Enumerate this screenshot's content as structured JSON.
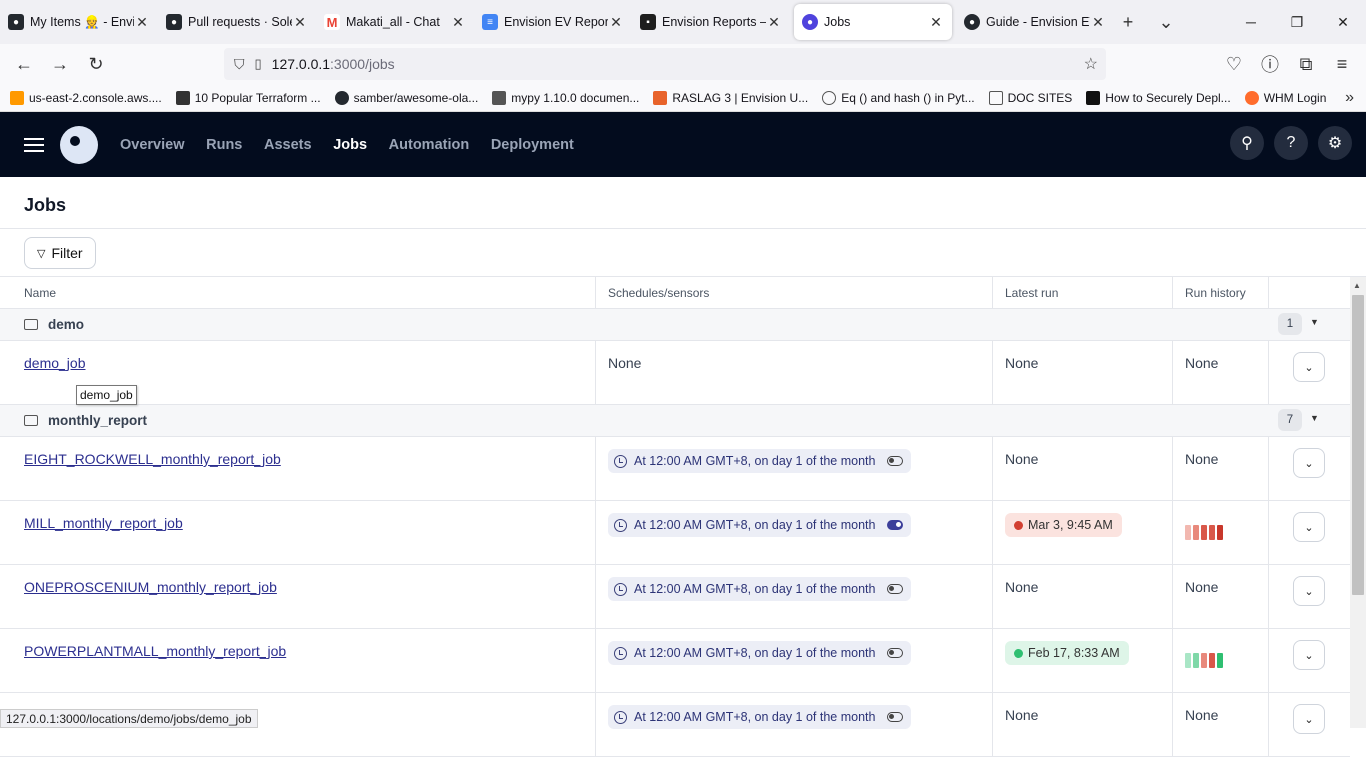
{
  "browser": {
    "tabs": [
      {
        "label": "My Items 👷 - Envis",
        "icon": "github-icon",
        "color": "#24292f"
      },
      {
        "label": "Pull requests · Soler",
        "icon": "github-icon",
        "color": "#24292f"
      },
      {
        "label": "Makati_all - Chat",
        "icon": "gmail-icon",
        "color": "#ea4335"
      },
      {
        "label": "Envision EV Report",
        "icon": "docs-icon",
        "color": "#4285f4"
      },
      {
        "label": "Envision Reports –",
        "icon": "figma-icon",
        "color": "#1e1e1e"
      },
      {
        "label": "Jobs",
        "icon": "dagster-icon",
        "color": "#4f43dd",
        "active": true
      },
      {
        "label": "Guide - Envision EV",
        "icon": "github-icon",
        "color": "#24292f"
      }
    ],
    "new_tab": "+",
    "tab_list": "⌄",
    "url_host": "127.0.0.1",
    "url_path": ":3000/jobs",
    "bookmarks": [
      {
        "label": "us-east-2.console.aws....",
        "color": "#ff9900"
      },
      {
        "label": "10 Popular Terraform ...",
        "color": "#333333"
      },
      {
        "label": "samber/awesome-ola...",
        "color": "#24292f"
      },
      {
        "label": "mypy 1.10.0 documen...",
        "color": "#555555"
      },
      {
        "label": "RASLAG 3 | Envision U...",
        "color": "#e8632b"
      },
      {
        "label": "Eq () and hash () in Pyt...",
        "color": "#666666"
      },
      {
        "label": "DOC SITES",
        "color": "#777777"
      },
      {
        "label": "How to Securely Depl...",
        "color": "#111111"
      },
      {
        "label": "WHM Login",
        "color": "#ff6c2c"
      }
    ],
    "status_url": "127.0.0.1:3000/locations/demo/jobs/demo_job"
  },
  "app": {
    "nav": [
      "Overview",
      "Runs",
      "Assets",
      "Jobs",
      "Automation",
      "Deployment"
    ],
    "active_nav": "Jobs",
    "page_title": "Jobs",
    "filter_label": "Filter"
  },
  "table": {
    "headers": [
      "Name",
      "Schedules/sensors",
      "Latest run",
      "Run history"
    ],
    "groups": [
      {
        "name": "demo",
        "count": "1"
      },
      {
        "name": "monthly_report",
        "count": "7"
      }
    ],
    "rows": [
      {
        "name": "demo_job",
        "schedule": "None",
        "latest": "None",
        "history": "None"
      },
      {
        "name": "EIGHT_ROCKWELL_monthly_report_job",
        "schedule": "At 12:00 AM GMT+8, on day 1 of the month",
        "toggle": "off",
        "latest": "None",
        "history": "None"
      },
      {
        "name": "MILL_monthly_report_job",
        "schedule": "At 12:00 AM GMT+8, on day 1 of the month",
        "toggle": "on",
        "latest": "Mar 3, 9:45 AM",
        "latest_status": "failed",
        "history_colors": [
          "#f2b8b0",
          "#e8897c",
          "#d9584a",
          "#d9584a",
          "#c8372b"
        ]
      },
      {
        "name": "ONEPROSCENIUM_monthly_report_job",
        "schedule": "At 12:00 AM GMT+8, on day 1 of the month",
        "toggle": "off",
        "latest": "None",
        "history": "None"
      },
      {
        "name": "POWERPLANTMALL_monthly_report_job",
        "schedule": "At 12:00 AM GMT+8, on day 1 of the month",
        "toggle": "off",
        "latest": "Feb 17, 8:33 AM",
        "latest_status": "success",
        "history_colors": [
          "#a9e6c6",
          "#7fd8a8",
          "#e8897c",
          "#d9584a",
          "#2fbf71"
        ]
      },
      {
        "name": "",
        "schedule": "At 12:00 AM GMT+8, on day 1 of the month",
        "toggle": "off",
        "latest": "None",
        "history": "None"
      }
    ],
    "tooltip": "demo_job"
  }
}
